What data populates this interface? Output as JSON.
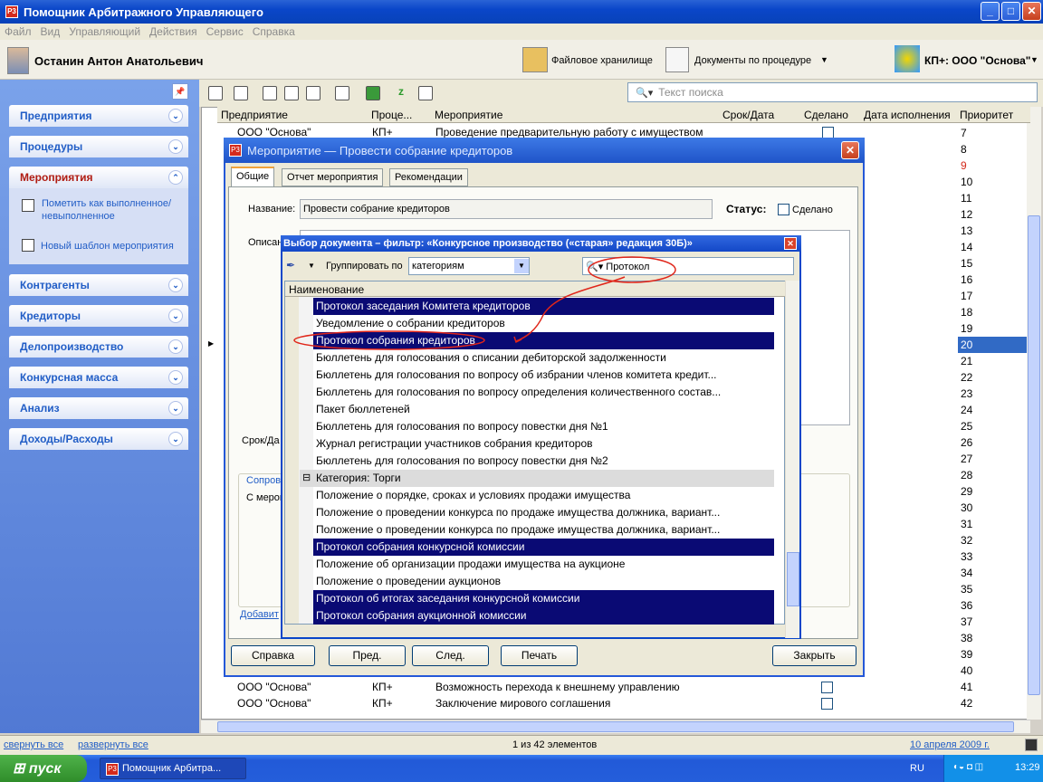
{
  "window": {
    "title": "Помощник Арбитражного Управляющего",
    "icon": "P3"
  },
  "menu": [
    "Файл",
    "Вид",
    "Управляющий",
    "Действия",
    "Сервис",
    "Справка"
  ],
  "userbar": {
    "user": "Останин Антон Анатольевич",
    "storage": "Файловое хранилище",
    "docs": "Документы по процедуре",
    "kp": "КП+: ООО \"Основа\""
  },
  "sidebar": {
    "items": [
      "Предприятия",
      "Процедуры",
      "Мероприятия",
      "Контрагенты",
      "Кредиторы",
      "Делопроизводство",
      "Конкурсная масса",
      "Анализ",
      "Доходы/Расходы"
    ],
    "panel": {
      "mark": "Пометить как выполненное/невыполненное",
      "template": "Новый шаблон мероприятия"
    }
  },
  "search": {
    "placeholder": "Текст поиска"
  },
  "grid": {
    "headers": [
      "Предприятие",
      "Проце...",
      "Мероприятие",
      "Срок/Дата",
      "Сделано",
      "Дата исполнения",
      "Приоритет"
    ],
    "first_row": [
      "ООО \"Основа\"",
      "КП+",
      "Проведение предварительную работу с имуществом"
    ],
    "priorities": [
      "7",
      "8",
      "9",
      "10",
      "11",
      "12",
      "13",
      "14",
      "15",
      "16",
      "17",
      "18",
      "19",
      "20",
      "21",
      "22",
      "23",
      "24",
      "25",
      "26",
      "27",
      "28",
      "29",
      "30",
      "31",
      "32",
      "33",
      "34",
      "35",
      "36",
      "37",
      "38",
      "39",
      "40",
      "41",
      "42"
    ],
    "bottom_rows": [
      [
        "ООО \"Основа\"",
        "КП+",
        "Возможность перехода к внешнему управлению"
      ],
      [
        "ООО \"Основа\"",
        "КП+",
        "Заключение мирового соглашения"
      ]
    ]
  },
  "dialog1": {
    "title": "Мероприятие — Провести собрание кредиторов",
    "tabs": [
      "Общие",
      "Отчет мероприятия",
      "Рекомендации"
    ],
    "name_label": "Название:",
    "name_value": "Провести собрание кредиторов",
    "status_label": "Статус:",
    "status_done": "Сделано",
    "desc_label": "Описан",
    "date_label": "Срок/Да",
    "soprov": "Сопрово",
    "merop": "С мероп",
    "add": "Добавит",
    "buttons": [
      "Справка",
      "Пред.",
      "След.",
      "Печать",
      "Закрыть"
    ]
  },
  "dialog2": {
    "title": "Выбор документа – фильтр: «Конкурсное производство («старая» редакция 30Б)»",
    "group_label": "Группировать по",
    "group_value": "категориям",
    "filter": "Протокол",
    "col": "Наименование",
    "items": [
      {
        "t": "Протокол заседания Комитета кредиторов",
        "sel": true
      },
      {
        "t": "Уведомление о собрании кредиторов",
        "sel": false
      },
      {
        "t": "Протокол собрания кредиторов",
        "sel": true
      },
      {
        "t": "Бюллетень для голосования о списании дебиторской задолженности",
        "sel": false
      },
      {
        "t": "Бюллетень  для  голосования  по  вопросу  об  избрании  членов  комитета  кредит...",
        "sel": false
      },
      {
        "t": "Бюллетень  для  голосования  по  вопросу  определения  количественного  состав...",
        "sel": false
      },
      {
        "t": "Пакет бюллетеней",
        "sel": false
      },
      {
        "t": "Бюллетень для голосования по вопросу повестки дня №1",
        "sel": false
      },
      {
        "t": "Журнал регистрации участников собрания кредиторов",
        "sel": false
      },
      {
        "t": "Бюллетень для голосования по вопросу повестки дня №2",
        "sel": false
      },
      {
        "t": "Категория: Торги",
        "sel": false,
        "cat": true
      },
      {
        "t": "Положение о порядке, сроках и условиях продажи имущества",
        "sel": false
      },
      {
        "t": "Положение  о  проведении  конкурса  по  продаже  имущества  должника,  вариант...",
        "sel": false
      },
      {
        "t": "Положение  о  проведении  конкурса  по  продаже  имущества  должника,  вариант...",
        "sel": false
      },
      {
        "t": "Протокол собрания конкурсной комиссии",
        "sel": true
      },
      {
        "t": "Положение об организации продажи имущества на аукционе",
        "sel": false
      },
      {
        "t": "Положение о проведении аукционов",
        "sel": false
      },
      {
        "t": "Протокол об итогах заседания конкурсной комиссии",
        "sel": true
      },
      {
        "t": "Протокол собрания аукционной комиссии",
        "sel": true
      }
    ]
  },
  "status": {
    "collapse": "свернуть все",
    "expand": "развернуть все",
    "count": "1 из 42 элементов",
    "date": "10 апреля 2009 г."
  },
  "taskbar": {
    "start": "пуск",
    "task": "Помощник Арбитра...",
    "lang": "RU",
    "time": "13:29"
  }
}
